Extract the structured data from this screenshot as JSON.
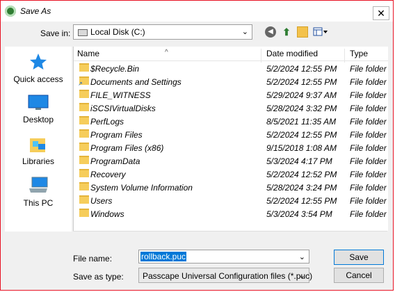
{
  "window": {
    "title": "Save As",
    "close_glyph": "✕"
  },
  "toolbar": {
    "save_in_label": "Save in:",
    "location": "Local Disk (C:)"
  },
  "places": [
    {
      "label": "Quick access",
      "icon": "star-icon"
    },
    {
      "label": "Desktop",
      "icon": "desktop-icon"
    },
    {
      "label": "Libraries",
      "icon": "libraries-icon"
    },
    {
      "label": "This PC",
      "icon": "computer-icon"
    }
  ],
  "columns": {
    "name": "Name",
    "date": "Date modified",
    "type": "Type"
  },
  "files": [
    {
      "name": "$Recycle.Bin",
      "date": "5/2/2024 12:55 PM",
      "type": "File folder"
    },
    {
      "name": "Documents and Settings",
      "date": "5/2/2024 12:55 PM",
      "type": "File folder",
      "shortcut": true
    },
    {
      "name": "FILE_WITNESS",
      "date": "5/29/2024 9:37 AM",
      "type": "File folder"
    },
    {
      "name": "iSCSIVirtualDisks",
      "date": "5/28/2024 3:32 PM",
      "type": "File folder"
    },
    {
      "name": "PerfLogs",
      "date": "8/5/2021 11:35 AM",
      "type": "File folder"
    },
    {
      "name": "Program Files",
      "date": "5/2/2024 12:55 PM",
      "type": "File folder"
    },
    {
      "name": "Program Files (x86)",
      "date": "9/15/2018 1:08 AM",
      "type": "File folder"
    },
    {
      "name": "ProgramData",
      "date": "5/3/2024 4:17 PM",
      "type": "File folder"
    },
    {
      "name": "Recovery",
      "date": "5/2/2024 12:52 PM",
      "type": "File folder"
    },
    {
      "name": "System Volume Information",
      "date": "5/28/2024 3:24 PM",
      "type": "File folder"
    },
    {
      "name": "Users",
      "date": "5/2/2024 12:55 PM",
      "type": "File folder"
    },
    {
      "name": "Windows",
      "date": "5/3/2024 3:54 PM",
      "type": "File folder"
    }
  ],
  "form": {
    "file_name_label": "File name:",
    "file_name_value": "rollback.puc",
    "save_type_label": "Save as type:",
    "save_type_value": "Passcape Universal Configuration files (*.puc)"
  },
  "buttons": {
    "save": "Save",
    "cancel": "Cancel"
  },
  "colors": {
    "accent": "#0078d7",
    "border_red": "#e81123",
    "folder": "#f6cd5b"
  }
}
